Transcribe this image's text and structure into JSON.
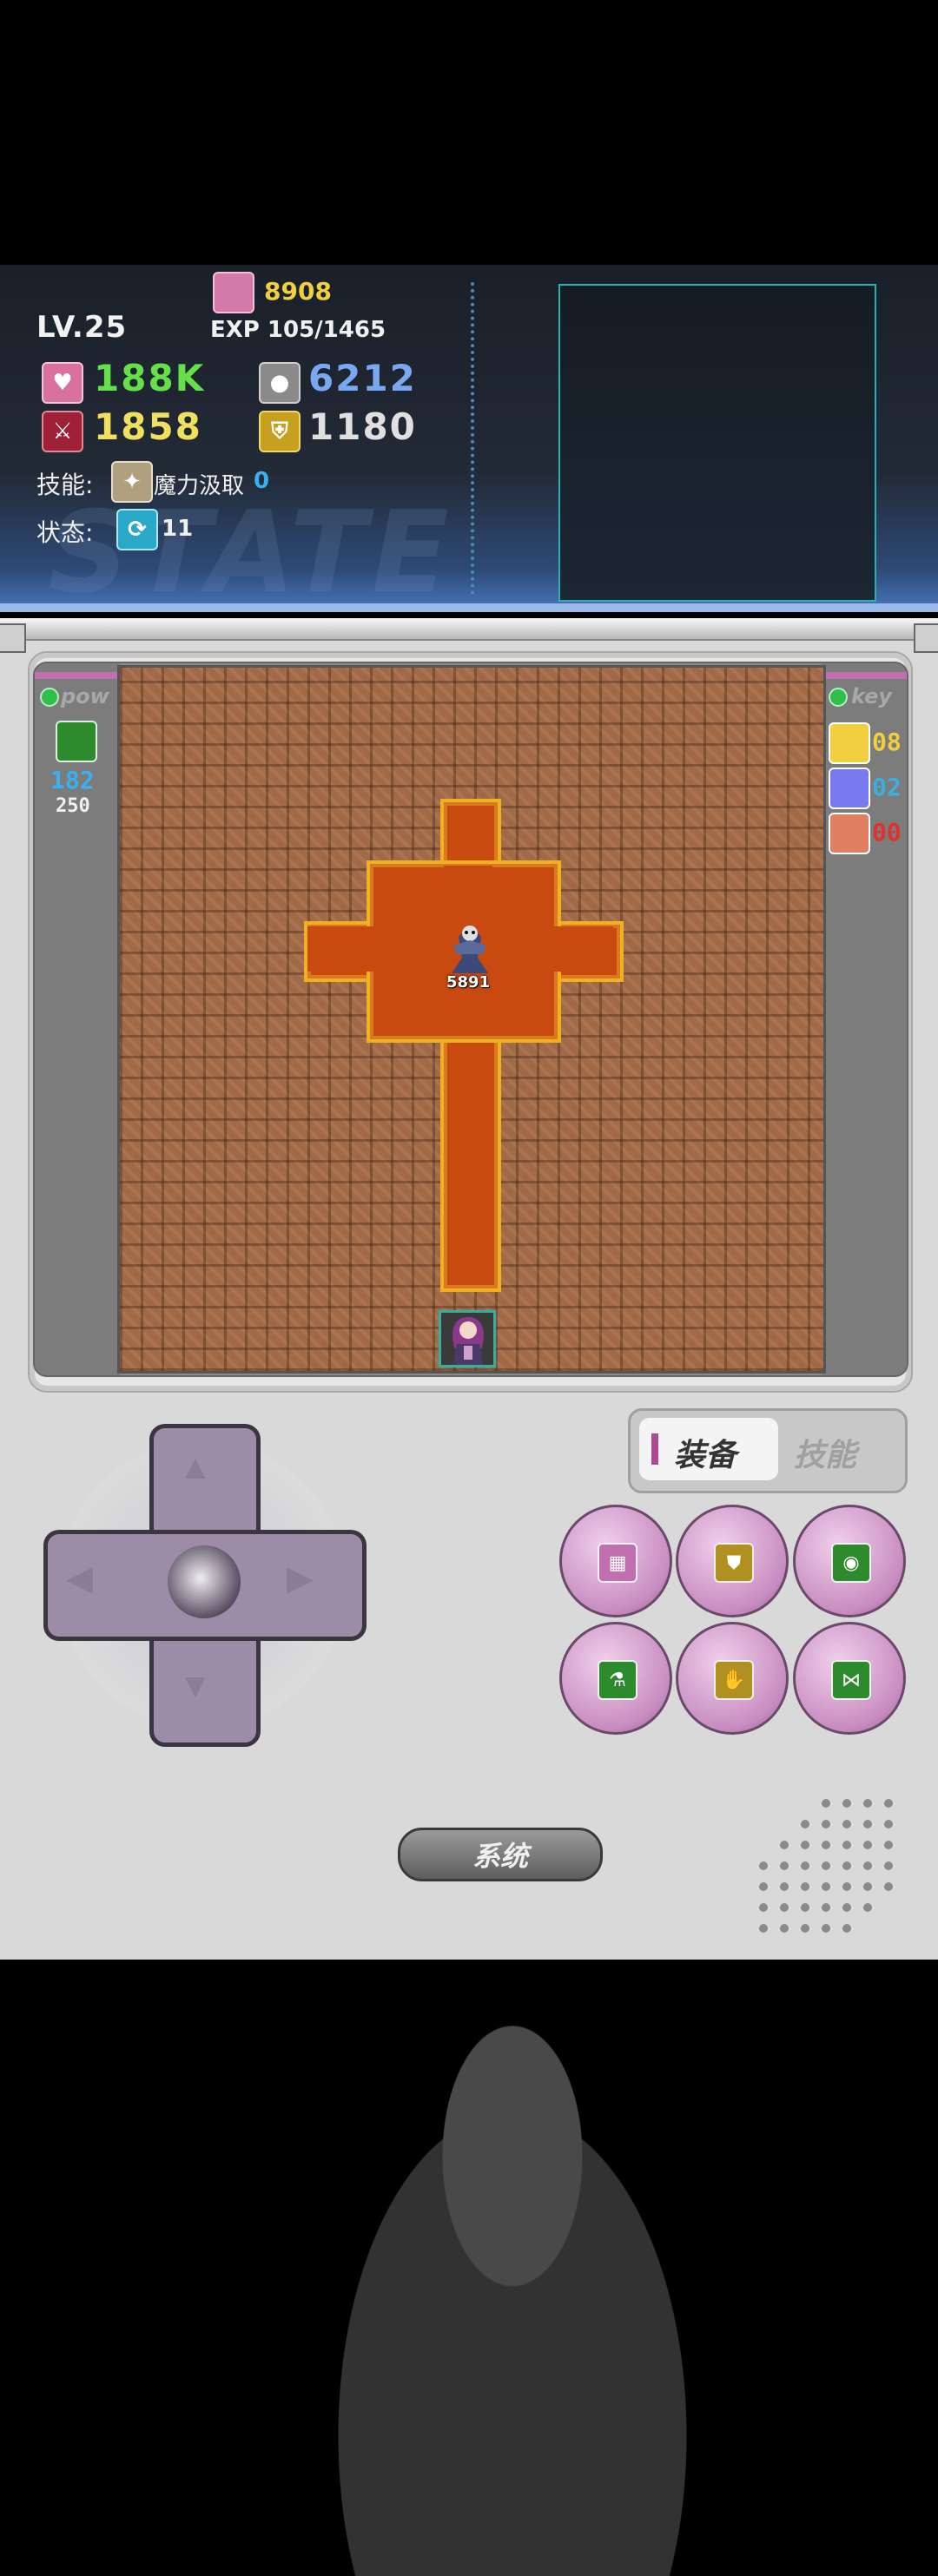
{
  "stats": {
    "level": "LV.25",
    "gold": "8908",
    "exp": "EXP 105/1465",
    "hp": "188K",
    "mp": "6212",
    "atk": "1858",
    "def": "1180",
    "skill_label": "技能:",
    "skill_name": "魔力汲取",
    "skill_value": "0",
    "state_label": "状态:",
    "state_value": "11",
    "watermark": "STATE"
  },
  "pow_panel": {
    "title": "pow",
    "value_current": "182",
    "value_max": "250"
  },
  "key_panel": {
    "title": "key",
    "keys": [
      {
        "count": "08",
        "color": "#f0d040"
      },
      {
        "count": "02",
        "color": "#3ab0e0"
      },
      {
        "count": "00",
        "color": "#e03030"
      }
    ]
  },
  "map": {
    "boss_value": "5891"
  },
  "tabs": {
    "equip": "装备",
    "skills": "技能"
  },
  "item_buttons": [
    {
      "icon": "maze-icon"
    },
    {
      "icon": "armor-icon"
    },
    {
      "icon": "mask-icon"
    },
    {
      "icon": "flask-icon"
    },
    {
      "icon": "glove-icon"
    },
    {
      "icon": "bow-icon"
    }
  ],
  "system_button": "系统",
  "colors": {
    "hp": "#66e04a",
    "mp": "#7aa8f0",
    "atk": "#f0e060",
    "def": "#e0e0e0",
    "gold": "#f0d040",
    "carpet": "#c84a10"
  }
}
